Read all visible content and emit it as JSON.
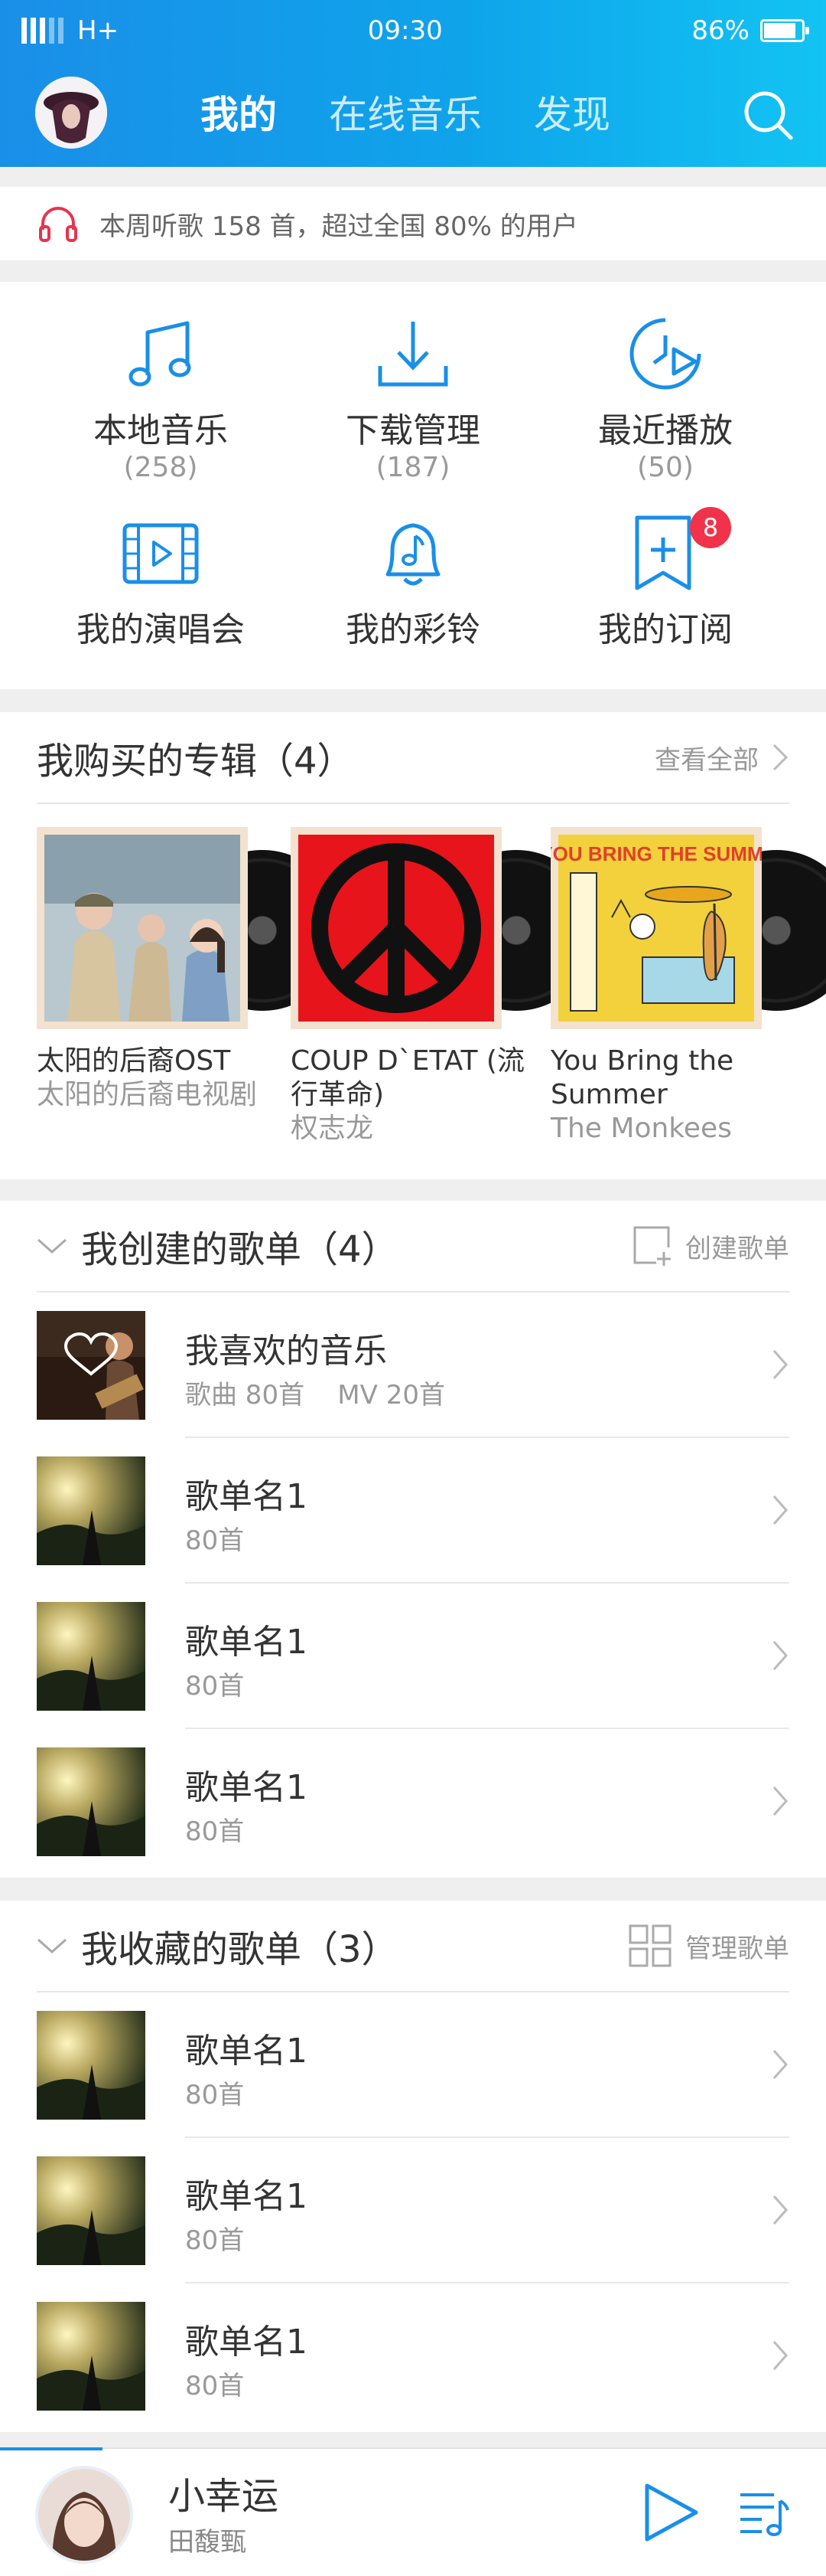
{
  "status_bar": {
    "network": "H+",
    "time": "09:30",
    "battery": "86%",
    "battery_level": 0.86
  },
  "header": {
    "tabs": [
      {
        "label": "我的",
        "active": true
      },
      {
        "label": "在线音乐",
        "active": false
      },
      {
        "label": "发现",
        "active": false
      }
    ]
  },
  "stat": {
    "text": "本周听歌 158 首，超过全国 80% 的用户"
  },
  "quick": [
    {
      "label": "本地音乐",
      "count": "(258)",
      "icon": "music-note-icon"
    },
    {
      "label": "下载管理",
      "count": "(187)",
      "icon": "download-icon"
    },
    {
      "label": "最近播放",
      "count": "(50)",
      "icon": "recent-play-icon"
    },
    {
      "label": "我的演唱会",
      "icon": "concert-video-icon"
    },
    {
      "label": "我的彩铃",
      "icon": "ringtone-bell-icon"
    },
    {
      "label": "我的订阅",
      "icon": "subscribe-bookmark-icon",
      "badge": "8"
    }
  ],
  "albums": {
    "title": "我购买的专辑（4）",
    "view_all": "查看全部",
    "items": [
      {
        "name": "太阳的后裔OST",
        "artist": "太阳的后裔电视剧"
      },
      {
        "name": "COUP D`ETAT (流行革命)",
        "artist": "权志龙"
      },
      {
        "name": "You Bring the Summer",
        "artist": " The Monkees",
        "cover_text": "YOU BRING THE SUMMER"
      }
    ]
  },
  "created": {
    "title": "我创建的歌单（4）",
    "action": "创建歌单",
    "items": [
      {
        "name": "我喜欢的音乐",
        "sub": "歌曲 80首    MV 20首"
      },
      {
        "name": "歌单名1",
        "sub": "80首"
      },
      {
        "name": "歌单名1",
        "sub": "80首"
      },
      {
        "name": "歌单名1",
        "sub": "80首"
      }
    ]
  },
  "collected": {
    "title": "我收藏的歌单（3）",
    "action": "管理歌单",
    "items": [
      {
        "name": "歌单名1",
        "sub": "80首"
      },
      {
        "name": "歌单名1",
        "sub": "80首"
      },
      {
        "name": "歌单名1",
        "sub": "80首"
      }
    ]
  },
  "player": {
    "title": "小幸运",
    "artist": "田馥甄"
  },
  "colors": {
    "header_start": "#1a8fe8",
    "header_end": "#12c3f3",
    "accent": "#1a8fe8",
    "badge": "#f0334a",
    "headphone": "#e8334f"
  }
}
